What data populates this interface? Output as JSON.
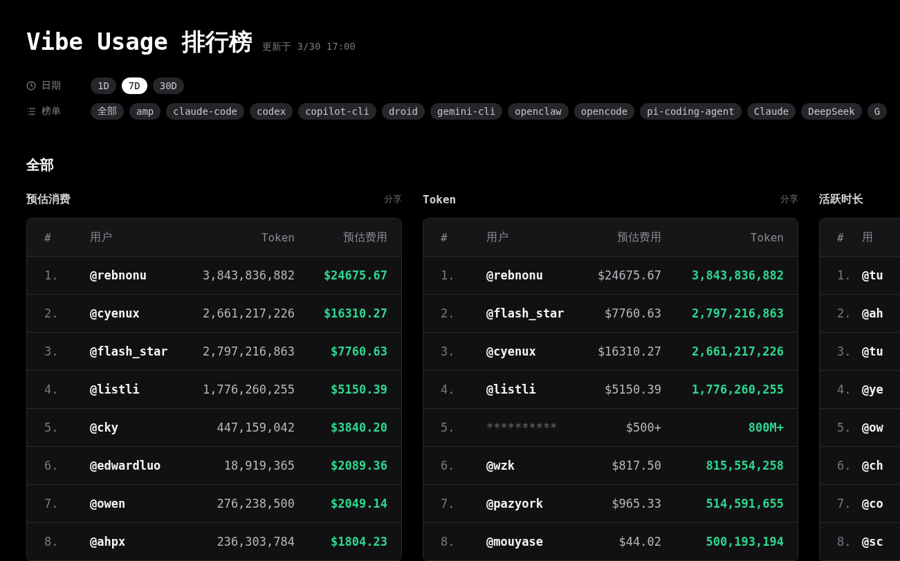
{
  "header": {
    "title": "Vibe Usage 排行榜",
    "updated": "更新于 3/30 17:00"
  },
  "filters": [
    {
      "kind": "date",
      "label": "日期",
      "options": [
        {
          "label": "1D",
          "selected": false
        },
        {
          "label": "7D",
          "selected": true
        },
        {
          "label": "30D",
          "selected": false
        }
      ]
    },
    {
      "kind": "list",
      "label": "榜单",
      "options": [
        {
          "label": "全部",
          "selected": false
        },
        {
          "label": "amp",
          "selected": false
        },
        {
          "label": "claude-code",
          "selected": false
        },
        {
          "label": "codex",
          "selected": false
        },
        {
          "label": "copilot-cli",
          "selected": false
        },
        {
          "label": "droid",
          "selected": false
        },
        {
          "label": "gemini-cli",
          "selected": false
        },
        {
          "label": "openclaw",
          "selected": false
        },
        {
          "label": "opencode",
          "selected": false
        },
        {
          "label": "pi-coding-agent",
          "selected": false
        },
        {
          "label": "Claude",
          "selected": false
        },
        {
          "label": "DeepSeek",
          "selected": false
        },
        {
          "label": "G",
          "selected": false
        }
      ]
    }
  ],
  "section_title": "全部",
  "boards": [
    {
      "title": "预估消费",
      "share": "分享",
      "columns": [
        "#",
        "用户",
        "Token",
        "预估费用"
      ],
      "rows": [
        {
          "rank": "1.",
          "user": "@rebnonu",
          "value": "3,843,836,882",
          "highlight": "$24675.67",
          "masked": false
        },
        {
          "rank": "2.",
          "user": "@cyenux",
          "value": "2,661,217,226",
          "highlight": "$16310.27",
          "masked": false
        },
        {
          "rank": "3.",
          "user": "@flash_star",
          "value": "2,797,216,863",
          "highlight": "$7760.63",
          "masked": false
        },
        {
          "rank": "4.",
          "user": "@listli",
          "value": "1,776,260,255",
          "highlight": "$5150.39",
          "masked": false
        },
        {
          "rank": "5.",
          "user": "@cky",
          "value": "447,159,042",
          "highlight": "$3840.20",
          "masked": false
        },
        {
          "rank": "6.",
          "user": "@edwardluo",
          "value": "18,919,365",
          "highlight": "$2089.36",
          "masked": false
        },
        {
          "rank": "7.",
          "user": "@owen",
          "value": "276,238,500",
          "highlight": "$2049.14",
          "masked": false
        },
        {
          "rank": "8.",
          "user": "@ahpx",
          "value": "236,303,784",
          "highlight": "$1804.23",
          "masked": false
        }
      ]
    },
    {
      "title": "Token",
      "share": "分享",
      "columns": [
        "#",
        "用户",
        "预估费用",
        "Token"
      ],
      "rows": [
        {
          "rank": "1.",
          "user": "@rebnonu",
          "value": "$24675.67",
          "highlight": "3,843,836,882",
          "masked": false
        },
        {
          "rank": "2.",
          "user": "@flash_star",
          "value": "$7760.63",
          "highlight": "2,797,216,863",
          "masked": false
        },
        {
          "rank": "3.",
          "user": "@cyenux",
          "value": "$16310.27",
          "highlight": "2,661,217,226",
          "masked": false
        },
        {
          "rank": "4.",
          "user": "@listli",
          "value": "$5150.39",
          "highlight": "1,776,260,255",
          "masked": false
        },
        {
          "rank": "5.",
          "user": "**********",
          "value": "$500+",
          "highlight": "800M+",
          "masked": true
        },
        {
          "rank": "6.",
          "user": "@wzk",
          "value": "$817.50",
          "highlight": "815,554,258",
          "masked": false
        },
        {
          "rank": "7.",
          "user": "@pazyork",
          "value": "$965.33",
          "highlight": "514,591,655",
          "masked": false
        },
        {
          "rank": "8.",
          "user": "@mouyase",
          "value": "$44.02",
          "highlight": "500,193,194",
          "masked": false
        }
      ]
    },
    {
      "title": "活跃时长",
      "columns": [
        "#",
        "用"
      ],
      "rows": [
        {
          "rank": "1.",
          "user": "@tu",
          "masked": false
        },
        {
          "rank": "2.",
          "user": "@ah",
          "masked": false
        },
        {
          "rank": "3.",
          "user": "@tu",
          "masked": false
        },
        {
          "rank": "4.",
          "user": "@ye",
          "masked": false
        },
        {
          "rank": "5.",
          "user": "@ow",
          "masked": false
        },
        {
          "rank": "6.",
          "user": "@ch",
          "masked": false
        },
        {
          "rank": "7.",
          "user": "@co",
          "masked": false
        },
        {
          "rank": "8.",
          "user": "@sc",
          "masked": false
        }
      ]
    }
  ]
}
